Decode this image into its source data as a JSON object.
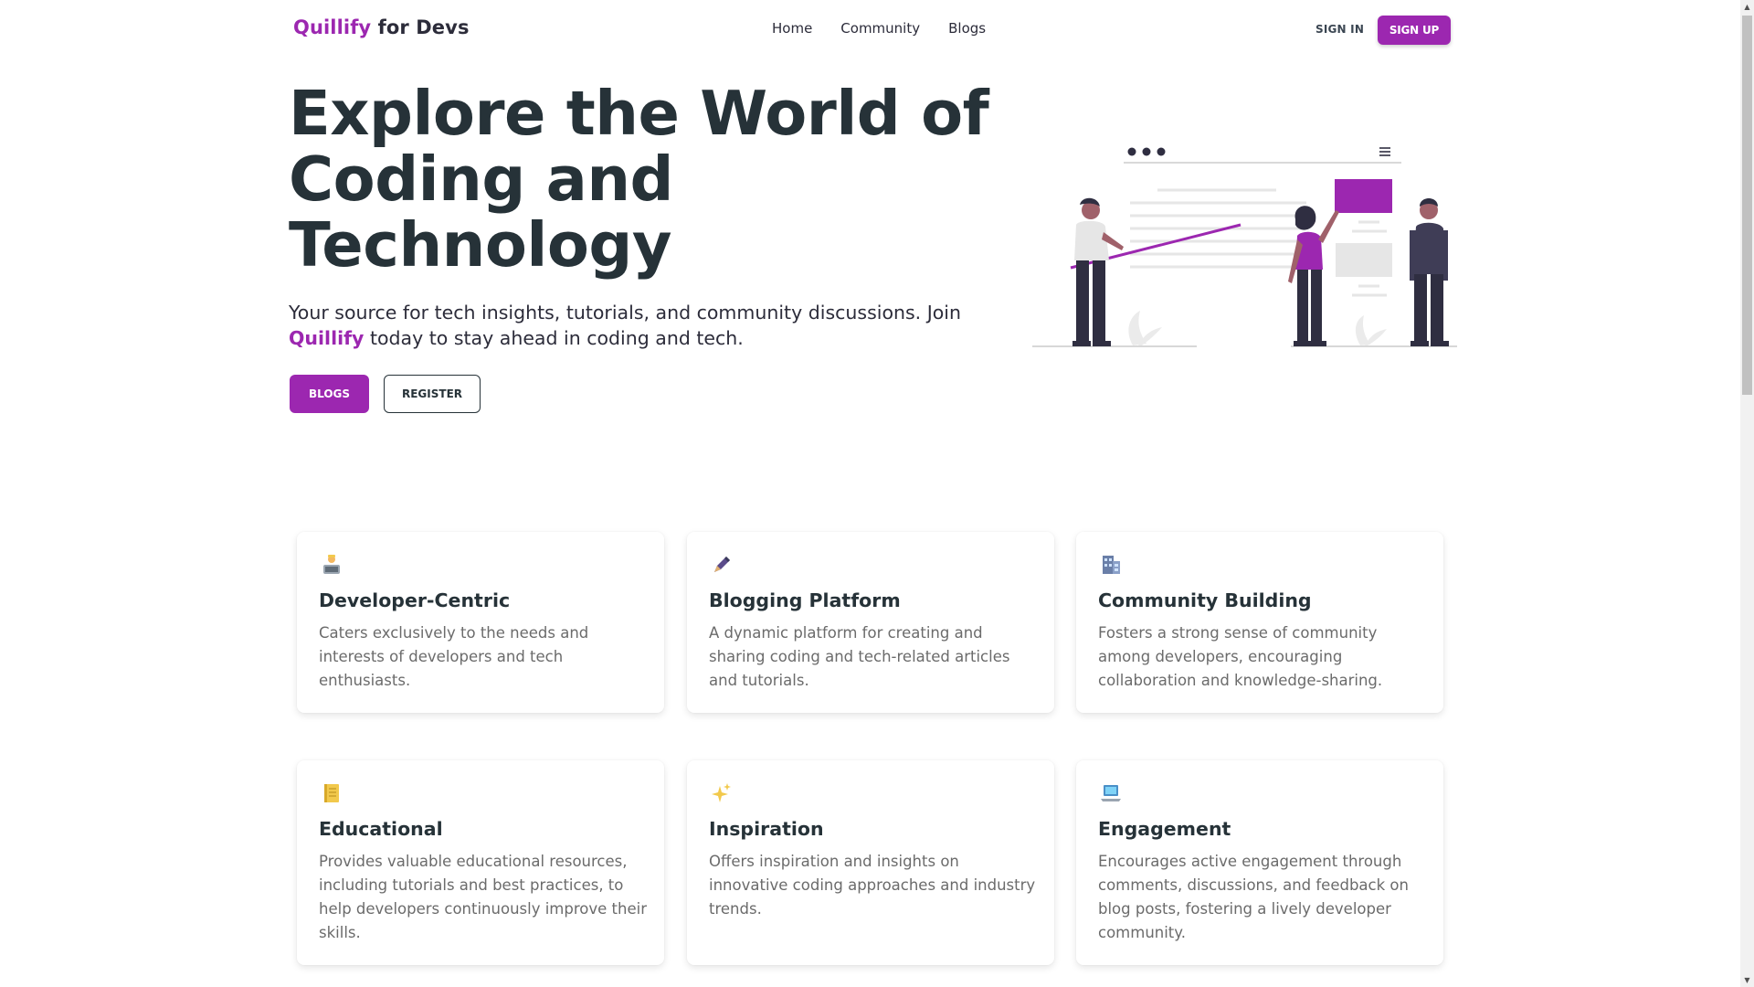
{
  "navbar": {
    "brand_accent": "Quillify",
    "brand_rest": " for Devs",
    "links": [
      "Home",
      "Community",
      "Blogs"
    ],
    "sign_in": "SIGN IN",
    "sign_up": "SIGN UP"
  },
  "hero": {
    "title": "Explore the World of Coding and Technology",
    "subtitle_part1": "Your source for tech insights, tutorials, and community discussions. Join ",
    "subtitle_accent": "Quillify",
    "subtitle_part2": " today to stay ahead in coding and tech.",
    "btn_blogs": "BLOGS",
    "btn_register": "REGISTER"
  },
  "features": [
    {
      "icon": "developer-icon",
      "title": "Developer-Centric",
      "text": "Caters exclusively to the needs and interests of developers and tech enthusiasts."
    },
    {
      "icon": "pen-icon",
      "title": "Blogging Platform",
      "text": "A dynamic platform for creating and sharing coding and tech-related articles and tutorials."
    },
    {
      "icon": "buildings-icon",
      "title": "Community Building",
      "text": "Fosters a strong sense of community among developers, encouraging collaboration and knowledge-sharing."
    },
    {
      "icon": "notebook-icon",
      "title": "Educational",
      "text": "Provides valuable educational resources, including tutorials and best practices, to help developers continuously improve their skills."
    },
    {
      "icon": "sparkles-icon",
      "title": "Inspiration",
      "text": "Offers inspiration and insights on innovative coding approaches and industry trends."
    },
    {
      "icon": "laptop-icon",
      "title": "Engagement",
      "text": "Encourages active engagement through comments, discussions, and feedback on blog posts, fostering a lively developer community."
    }
  ],
  "colors": {
    "accent": "#9c27b0",
    "heading": "#263238",
    "body_text": "#6b6b6b"
  }
}
